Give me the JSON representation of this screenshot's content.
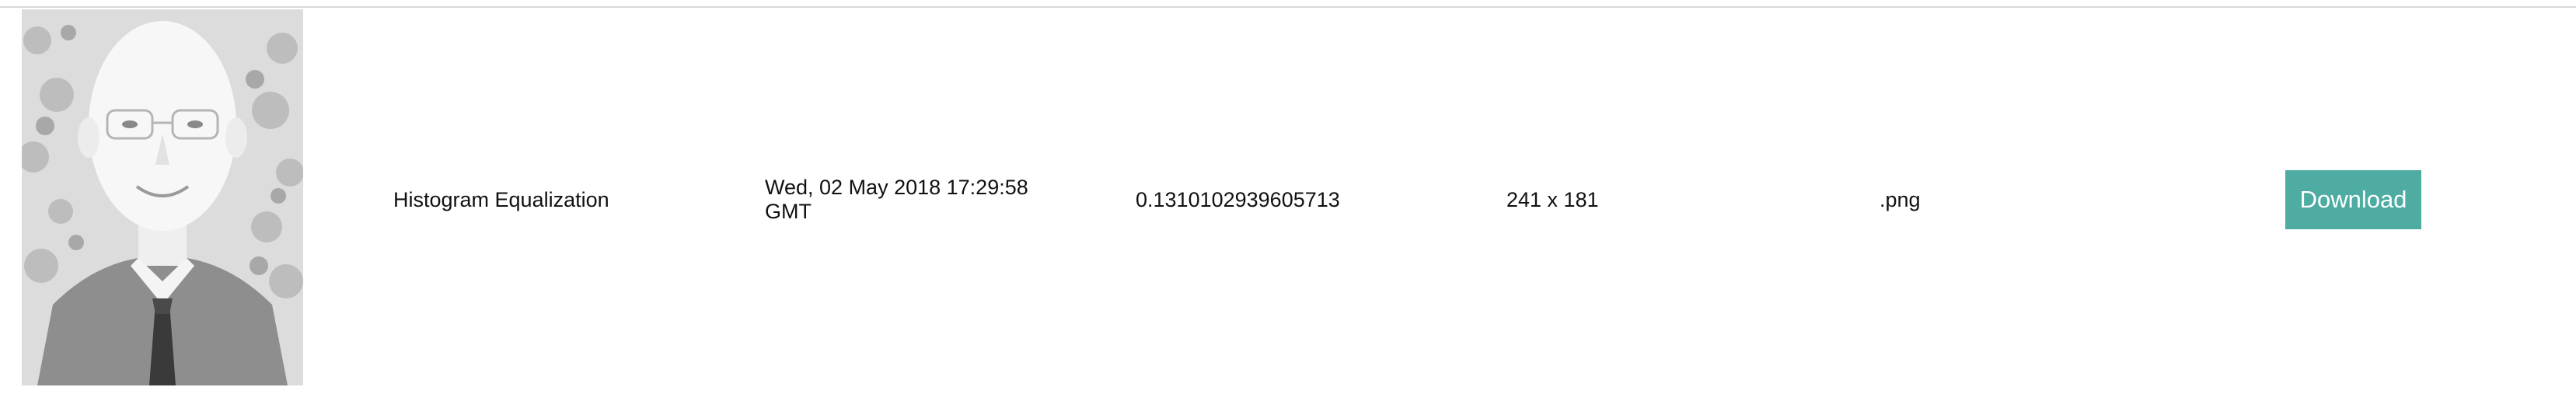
{
  "row": {
    "thumbnail_alt": "processed image thumbnail",
    "filter_name": "Histogram Equalization",
    "timestamp": "Wed, 02 May 2018 17:29:58 GMT",
    "process_time": "0.1310102939605713",
    "image_size": "241 x 181",
    "extension": ".png",
    "download_label": "Download"
  },
  "colors": {
    "button_bg": "#4eaca3",
    "button_text": "#ffffff",
    "divider": "#d9d9d9"
  }
}
